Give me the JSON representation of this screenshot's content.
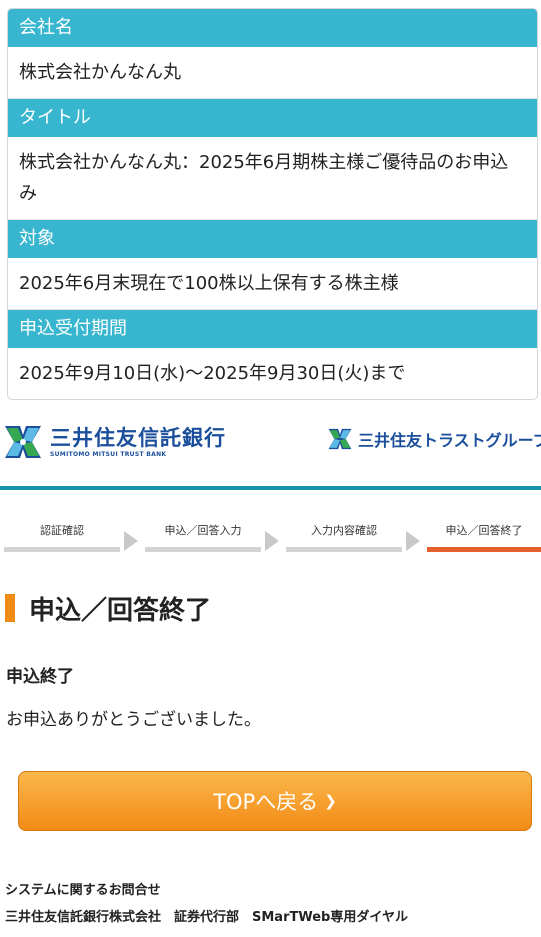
{
  "info": {
    "company_label": "会社名",
    "company_value": "株式会社かんなん丸",
    "title_label": "タイトル",
    "title_value": "株式会社かんなん丸：2025年6月期株主様ご優待品のお申込み",
    "target_label": "対象",
    "target_value": "2025年6月末現在で100株以上保有する株主様",
    "period_label": "申込受付期間",
    "period_value": "2025年9月10日(水)～2025年9月30日(火)まで"
  },
  "brand": {
    "name": "三井住友信託銀行",
    "name_en": "SUMITOMO MITSUI TRUST BANK",
    "group": "三井住友トラストグループ",
    "colors": {
      "blue": "#1b4f9c",
      "green": "#36a852",
      "teal": "#1693a8"
    }
  },
  "steps": [
    {
      "label": "認証確認",
      "active": false
    },
    {
      "label": "申込／回答入力",
      "active": false
    },
    {
      "label": "入力内容確認",
      "active": false
    },
    {
      "label": "申込／回答終了",
      "active": true
    }
  ],
  "page": {
    "title": "申込／回答終了",
    "subheading": "申込終了",
    "message": "お申込ありがとうございました。"
  },
  "button": {
    "label": "TOPへ戻る",
    "icon": "chevron-right-icon"
  },
  "footer": {
    "line1": "システムに関するお問合せ",
    "line2": "三井住友信託銀行株式会社　証券代行部　SMarTWeb専用ダイヤル"
  },
  "colors": {
    "header_bg": "#38b6cf",
    "accent_orange": "#ef8a14",
    "step_active": "#e4602a"
  }
}
